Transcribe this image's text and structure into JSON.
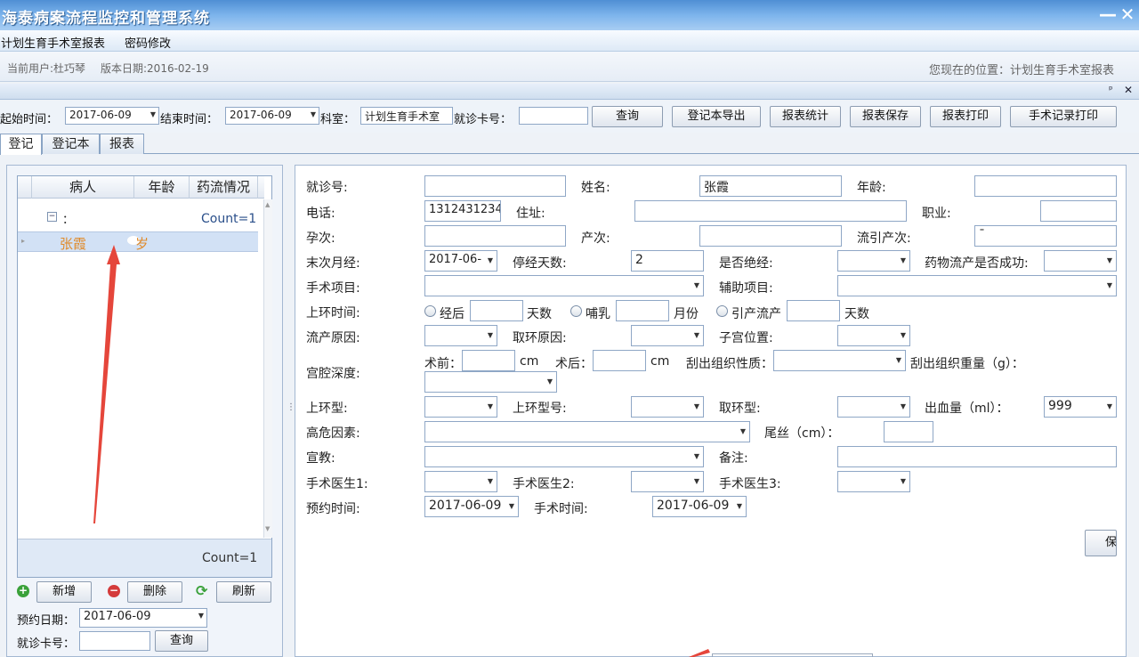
{
  "app": {
    "title": "海泰病案流程监控和管理系统",
    "minimize": "—",
    "close": "✕"
  },
  "menu": {
    "items": [
      "计划生育手术室报表",
      "密码修改"
    ]
  },
  "info": {
    "user": "当前用户:杜巧琴",
    "version": "版本日期:2016-02-19",
    "location": "您现在的位置：计划生育手术室报表"
  },
  "panel": {
    "pin": "ᵖ",
    "close": "✕"
  },
  "query": {
    "start_label": "起始时间：",
    "start_value": "2017-06-09",
    "end_label": "结束时间：",
    "end_value": "2017-06-09",
    "dept_label": "科室：",
    "dept_value": "计划生育手术室",
    "card_label": "就诊卡号：",
    "card_value": "",
    "buttons": [
      "查询",
      "登记本导出",
      "报表统计",
      "报表保存",
      "报表打印",
      "手术记录打印"
    ]
  },
  "tabs": [
    "登记",
    "登记本",
    "报表"
  ],
  "grid": {
    "headers": [
      "病人",
      "年龄",
      "药流情况"
    ],
    "group_label": "：",
    "group_count": "Count=1",
    "rows": [
      {
        "name": "张霞",
        "age": "岁"
      }
    ],
    "footer_count": "Count=1"
  },
  "left_actions": {
    "add": "新增",
    "delete": "删除",
    "refresh": "刷新"
  },
  "left_search": {
    "date_label": "预约日期：",
    "date_value": "2017-06-09",
    "card_label": "就诊卡号：",
    "card_value": "",
    "search": "查询"
  },
  "form": {
    "visit_no": {
      "label": "就诊号:",
      "value": ""
    },
    "name": {
      "label": "姓名:",
      "value": "张霞"
    },
    "age": {
      "label": "年龄:",
      "value": ""
    },
    "phone": {
      "label": "电话:",
      "value": "1312431234"
    },
    "address": {
      "label": "住址:",
      "value": ""
    },
    "job": {
      "label": "职业:",
      "value": ""
    },
    "pregnancy": {
      "label": "孕次:",
      "value": ""
    },
    "birth": {
      "label": "产次:",
      "value": ""
    },
    "abortion": {
      "label": "流引产次:",
      "value": "ˉ"
    },
    "lmp": {
      "label": "末次月经:",
      "value": "2017-06-"
    },
    "amenorrhea": {
      "label": "停经天数:",
      "value": "2"
    },
    "menopause": {
      "label": "是否绝经:",
      "value": ""
    },
    "drug_success": {
      "label": "药物流产是否成功:",
      "value": ""
    },
    "surgery": {
      "label": "手术项目:",
      "value": ""
    },
    "aux": {
      "label": "辅助项目:",
      "value": ""
    },
    "iud_time": {
      "label": "上环时间:",
      "opt1": "经后",
      "unit1": "天数",
      "opt2": "哺乳",
      "unit2": "月份",
      "opt3": "引产流产",
      "unit3": "天数"
    },
    "abortion_reason": {
      "label": "流产原因:",
      "value": ""
    },
    "removal_reason": {
      "label": "取环原因:",
      "value": ""
    },
    "uterus_pos": {
      "label": "子宫位置:",
      "value": ""
    },
    "cavity": {
      "label": "宫腔深度:",
      "pre": "术前：",
      "post": "术后：",
      "unit": "cm",
      "tissue": "刮出组织性质：",
      "weight": "刮出组织重量（g）："
    },
    "iud_type": {
      "label": "上环型:",
      "value": ""
    },
    "iud_model": {
      "label": "上环型号:",
      "value": ""
    },
    "removal_type": {
      "label": "取环型:",
      "value": ""
    },
    "blood": {
      "label": "出血量（ml）：",
      "value": "999"
    },
    "risk": {
      "label": "高危因素:",
      "value": ""
    },
    "tail": {
      "label": "尾丝（cm）：",
      "value": ""
    },
    "education": {
      "label": "宣教:",
      "value": ""
    },
    "remark": {
      "label": "备注:",
      "value": ""
    },
    "doc1": {
      "label": "手术医生1:",
      "value": ""
    },
    "doc2": {
      "label": "手术医生2:",
      "value": ""
    },
    "doc3": {
      "label": "手术医生3:",
      "value": ""
    },
    "appoint": {
      "label": "预约时间:",
      "value": "2017-06-09"
    },
    "op_time": {
      "label": "手术时间:",
      "value": "2017-06-09"
    },
    "save": "保"
  },
  "colors": {
    "title_bg": "#5b9ae0",
    "accent": "#e5463b",
    "orange_text": "#e08a2a"
  }
}
